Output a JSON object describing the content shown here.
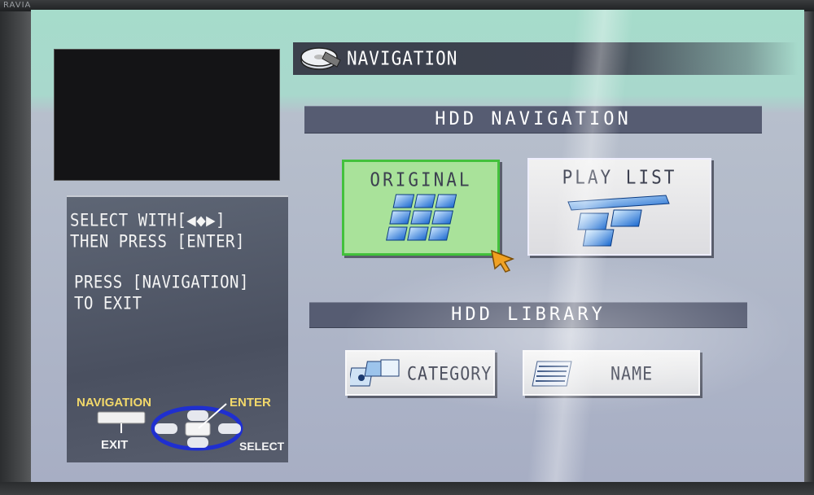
{
  "bezel": {
    "brand": "RAVIA"
  },
  "header": {
    "title": "NAVIGATION",
    "icon": "hdd-icon"
  },
  "hdd_navigation": {
    "title": "HDD NAVIGATION",
    "items": [
      {
        "label": "ORIGINAL",
        "icon": "original-grid-icon",
        "selected": true
      },
      {
        "label": "PLAY LIST",
        "icon": "playlist-icon",
        "selected": false
      }
    ]
  },
  "hdd_library": {
    "title": "HDD LIBRARY",
    "items": [
      {
        "label": "CATEGORY",
        "icon": "category-icon"
      },
      {
        "label": "NAME",
        "icon": "name-list-icon"
      }
    ]
  },
  "help": {
    "lines": [
      "SELECT WITH[◀◆▶]",
      "THEN PRESS [ENTER]",
      "PRESS [NAVIGATION]",
      "TO EXIT"
    ]
  },
  "legend": {
    "navigation": "NAVIGATION",
    "enter": "ENTER",
    "exit": "EXIT",
    "select": "SELECT"
  },
  "colors": {
    "selected_fill": "#a9e29a",
    "selected_border": "#43c13c",
    "bar": "#565c72",
    "legend_yellow": "#f2d86a",
    "cursor": "#f0a020"
  }
}
